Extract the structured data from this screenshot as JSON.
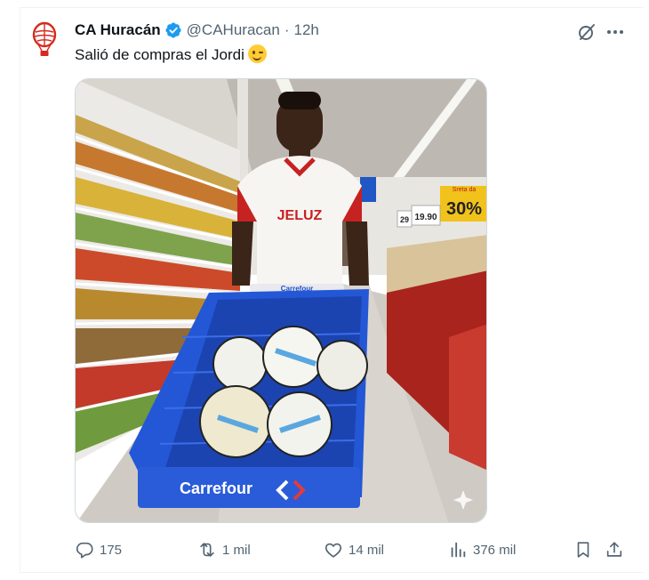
{
  "tweet": {
    "display_name": "CA Huracán",
    "handle": "@CAHuracan",
    "separator": "·",
    "time": "12h",
    "text": "Salió de compras el Jordi"
  },
  "icons": {
    "avatar": "huracan-crest-icon",
    "verified": "verified-badge-icon",
    "grok": "grok-icon",
    "more": "more-icon",
    "emoji": "winking-face-emoji",
    "reply": "reply-icon",
    "retweet": "retweet-icon",
    "like": "heart-icon",
    "views": "views-chart-icon",
    "bookmark": "bookmark-icon",
    "share": "share-icon"
  },
  "photo": {
    "shirt_sponsor": "JELUZ",
    "cart_brand": "Carrefour",
    "handle_brand": "Carrefour",
    "price_big": "30%",
    "price_tag": "19.90",
    "price_tag_2": "29",
    "sign_top": "Sreta da"
  },
  "stats": {
    "replies": "175",
    "retweets": "1 mil",
    "likes": "14 mil",
    "views": "376 mil"
  },
  "colors": {
    "accent": "#1d9bf0",
    "text_primary": "#0f1419",
    "text_secondary": "#536471",
    "border": "#cfd9de",
    "club_red": "#d52b1e",
    "cart_blue": "#1e4fc4"
  }
}
